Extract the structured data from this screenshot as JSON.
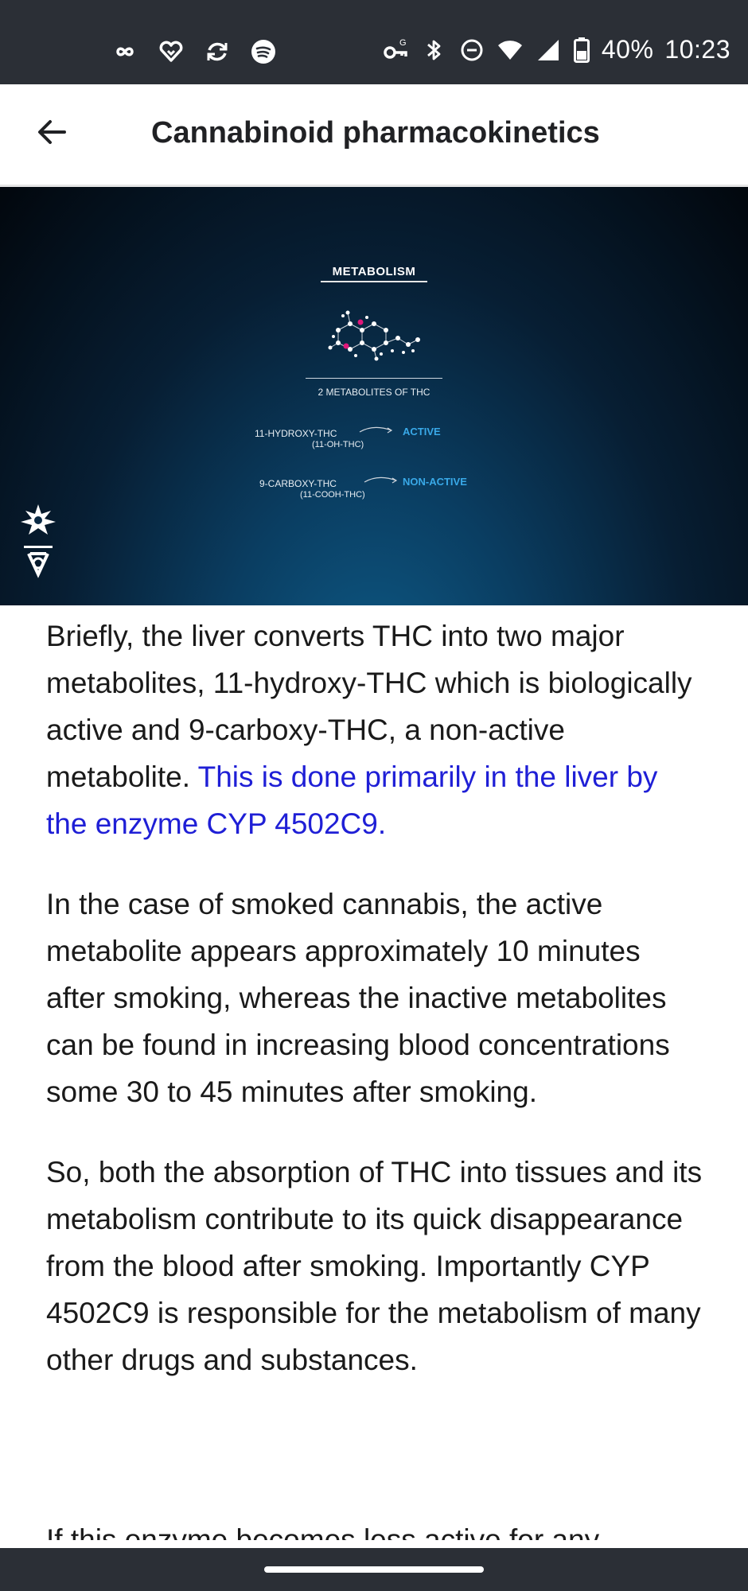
{
  "status_bar": {
    "left_icons": [
      "infinity-icon",
      "heart-icon",
      "sync-icon",
      "spotify-icon"
    ],
    "right_icons": [
      "vpn-key-icon",
      "bluetooth-icon",
      "do-not-disturb-icon",
      "wifi-icon",
      "signal-icon",
      "battery-icon"
    ],
    "battery": "40%",
    "time": "10:23"
  },
  "app_bar": {
    "back_icon": "arrow-left-icon",
    "title": "Cannabinoid pharmacokinetics"
  },
  "hero": {
    "heading": "METABOLISM",
    "subtitle": "2 METABOLITES OF THC",
    "metabolites": [
      {
        "name": "11-HYDROXY-THC",
        "abbr": "(11-OH-THC)",
        "status": "ACTIVE"
      },
      {
        "name": "9-CARBOXY-THC",
        "abbr": "(11-COOH-THC)",
        "status": "NON-ACTIVE"
      }
    ],
    "colors": {
      "status": "#39a9e8",
      "accent_atom": "#e0177a"
    }
  },
  "article": {
    "p1_text": "Briefly, the liver converts THC into two major metabolites, 11-hydroxy-THC which is biologically active and 9-carboxy-THC, a non-active metabolite. ",
    "p1_link": "This is done primarily in the liver by the enzyme CYP 4502C9.",
    "p2": "In the case of smoked cannabis, the active metabolite appears approximately 10 minutes after smoking, whereas the inactive metabolites can be found in increasing blood concentrations some 30 to 45 minutes after smoking.",
    "p3": "So, both the absorption of THC into tissues and its metabolism contribute to its quick disappearance from the blood after smoking. Importantly CYP 4502C9 is responsible for the metabolism of many other drugs and substances.",
    "p4_partial": "If this enzyme becomes less active for any"
  },
  "colors": {
    "link": "#1f1fd6",
    "system_bar": "#2b2f36"
  }
}
